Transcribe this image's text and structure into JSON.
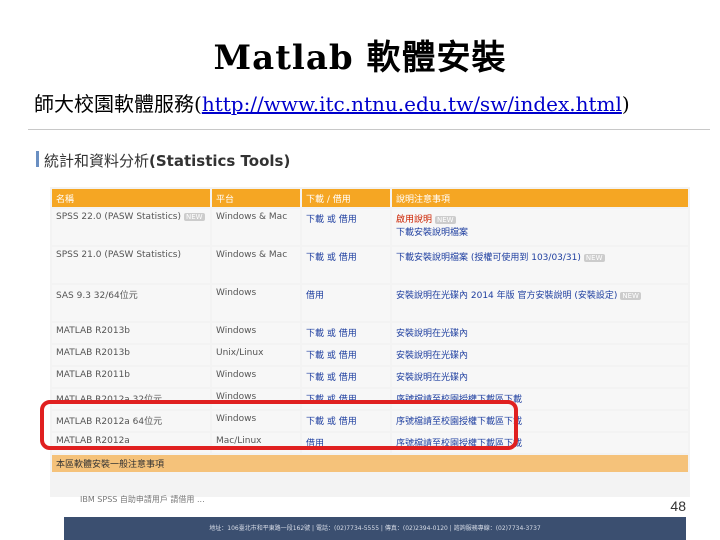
{
  "slide": {
    "title": "Matlab 軟體安裝",
    "subtitle_prefix": "師大校園軟體服務(",
    "subtitle_url": "http://www.itc.ntnu.edu.tw/sw/index.html",
    "subtitle_suffix": ")",
    "page_number": "48"
  },
  "section": {
    "title_zh": "統計和資料分析",
    "title_en": "(Statistics Tools)"
  },
  "table": {
    "headers": [
      "名稱",
      "平台",
      "下載 / 借用",
      "說明注意事項"
    ],
    "rows": [
      {
        "name": "SPSS 22.0 (PASW Statistics)",
        "name_badge": "NEW",
        "platform": "Windows & Mac",
        "download": "下載 或 借用",
        "notes_red": "啟用說明",
        "notes_badge": "NEW",
        "notes": "下載安裝說明檔案"
      },
      {
        "name": "SPSS 21.0 (PASW Statistics)",
        "name_badge": "",
        "platform": "Windows & Mac",
        "download": "下載 或 借用",
        "notes_red": "",
        "notes_badge": "NEW",
        "notes": "下載安裝說明檔案 (授權可使用到 103/03/31)"
      },
      {
        "name": "SAS 9.3 32/64位元",
        "name_badge": "",
        "platform": "Windows",
        "download": "借用",
        "notes_red": "",
        "notes_badge": "NEW",
        "notes": "安裝說明在光碟內 2014 年版 官方安裝說明 (安裝設定)"
      },
      {
        "name": "MATLAB R2013b",
        "name_badge": "",
        "platform": "Windows",
        "download": "下載 或 借用",
        "notes_red": "",
        "notes_badge": "",
        "notes": "安裝說明在光碟內"
      },
      {
        "name": "MATLAB R2013b",
        "name_badge": "",
        "platform": "Unix/Linux",
        "download": "下載 或 借用",
        "notes_red": "",
        "notes_badge": "",
        "notes": "安裝說明在光碟內"
      },
      {
        "name": "MATLAB R2011b",
        "name_badge": "",
        "platform": "Windows",
        "download": "下載 或 借用",
        "notes_red": "",
        "notes_badge": "",
        "notes": "安裝說明在光碟內"
      },
      {
        "name": "MATLAB R2012a 32位元",
        "name_badge": "",
        "platform": "Windows",
        "download": "下載 或 借用",
        "notes_red": "",
        "notes_badge": "",
        "notes": "序號檔請至校園授權下載區下載"
      },
      {
        "name": "MATLAB R2012a 64位元",
        "name_badge": "",
        "platform": "Windows",
        "download": "下載 或 借用",
        "notes_red": "",
        "notes_badge": "",
        "notes": "序號檔請至校園授權下載區下載"
      },
      {
        "name": "MATLAB R2012a",
        "name_badge": "",
        "platform": "Mac/Linux",
        "download": "借用",
        "notes_red": "",
        "notes_badge": "",
        "notes": "序號檔請至校園授權下載區下載"
      }
    ],
    "footer_note": "本區軟體安裝一般注意事項"
  },
  "faded_text": "IBM SPSS 自助申請用戶 請借用 ...",
  "site_footer": "地址：106臺北市和平東路一段162號 | 電話：(02)7734-5555 | 傳真：(02)2394-0120 | 諮詢服務專線：(02)7734-3737"
}
